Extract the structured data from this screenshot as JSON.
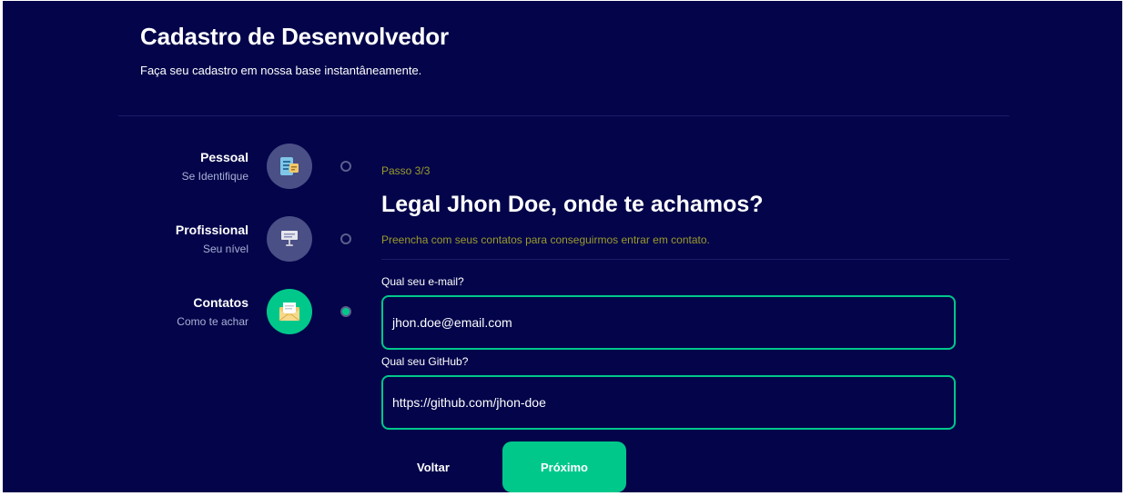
{
  "header": {
    "title": "Cadastro de Desenvolvedor",
    "subtitle": "Faça seu cadastro em nossa base instantâneamente."
  },
  "steps": [
    {
      "title": "Pessoal",
      "subtitle": "Se Identifique",
      "icon": "id-card-icon",
      "active": false
    },
    {
      "title": "Profissional",
      "subtitle": "Seu nível",
      "icon": "trophy-icon",
      "active": false
    },
    {
      "title": "Contatos",
      "subtitle": "Como te achar",
      "icon": "envelope-icon",
      "active": true
    }
  ],
  "main": {
    "step_indicator": "Passo 3/3",
    "heading": "Legal Jhon Doe, onde te achamos?",
    "description": "Preencha com seus contatos para conseguirmos entrar em contato.",
    "email": {
      "label": "Qual seu e-mail?",
      "value": "jhon.doe@email.com"
    },
    "github": {
      "label": "Qual seu GitHub?",
      "value": "https://github.com/jhon-doe"
    }
  },
  "actions": {
    "back_label": "Voltar",
    "next_label": "Próximo"
  },
  "colors": {
    "background": "#03044a",
    "accent": "#00c88b",
    "inactive_step": "#4a4f86",
    "hint_text": "#9b9b2a"
  }
}
